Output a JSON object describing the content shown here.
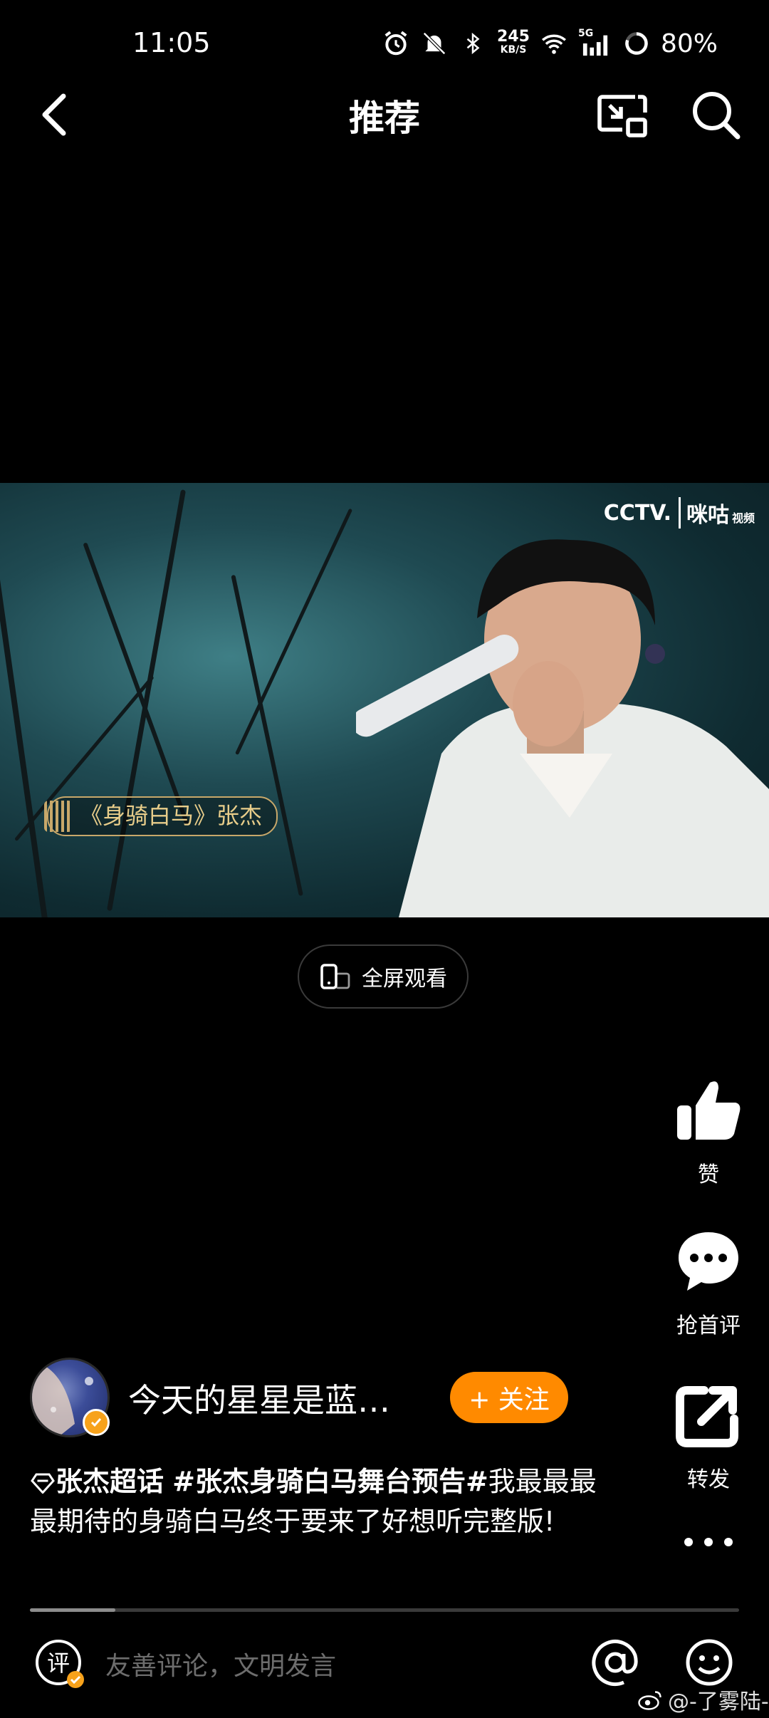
{
  "status_bar": {
    "time": "11:05",
    "network_speed": "245",
    "network_unit": "KB/S",
    "network_type": "5G",
    "battery": "80%"
  },
  "nav": {
    "title": "推荐"
  },
  "video": {
    "broadcaster_logo": "CCTV.",
    "partner_logo": "咪咕",
    "partner_sub": "视频",
    "song_badge": "《身骑白马》张杰"
  },
  "fullscreen_label": "全屏观看",
  "actions": {
    "like_label": "赞",
    "comment_label": "抢首评",
    "share_label": "转发"
  },
  "author": {
    "name": "今天的星星是蓝…",
    "follow_label": "+ 关注"
  },
  "caption": {
    "tag1": "张杰超话",
    "tag2": "#张杰身骑白马舞台预告#",
    "text": "我最最最最期待的身骑白马终于要来了好想听完整版!"
  },
  "progress": 0.12,
  "bottom_bar": {
    "comment_placeholder": "友善评论，文明发言",
    "watermark": "@-了雾陆-"
  },
  "colors": {
    "accent": "#ff8a00",
    "background": "#000000"
  }
}
